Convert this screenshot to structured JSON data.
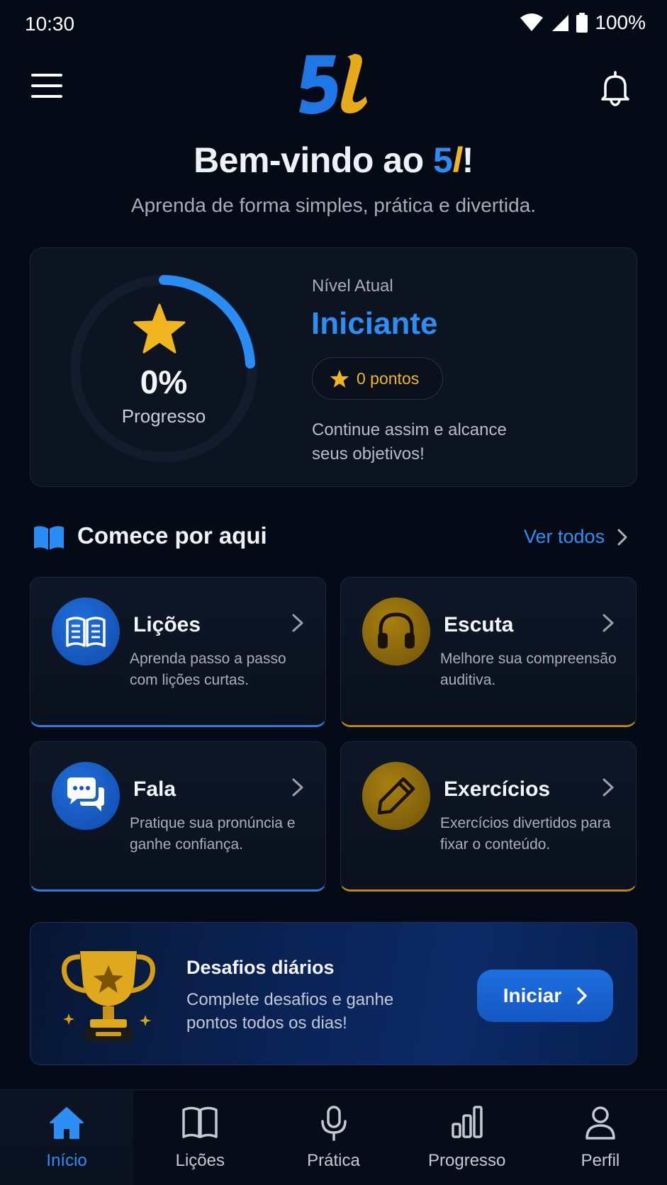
{
  "status_bar": {
    "time": "10:30",
    "battery": "100%"
  },
  "header": {
    "logo_text": "5l"
  },
  "welcome": {
    "title_prefix": "Bem-vindo ao ",
    "brand_5": "5",
    "brand_l": "l",
    "title_suffix": "!",
    "subtitle": "Aprenda de forma simples, prática e divertida."
  },
  "progress": {
    "percent": "0%",
    "percent_value": 0,
    "label": "Progresso",
    "level_caption": "Nível Atual",
    "level_name": "Iniciante",
    "points": "0 pontos",
    "message": "Continue assim e alcance seus objetivos!"
  },
  "section": {
    "title": "Comece por aqui",
    "see_all": "Ver todos"
  },
  "features": [
    {
      "title": "Lições",
      "description": "Aprenda passo a passo com lições curtas.",
      "icon": "book-icon",
      "accent": "#2a7de0"
    },
    {
      "title": "Escuta",
      "description": "Melhore sua compreensão auditiva.",
      "icon": "headphones-icon",
      "accent": "#b68718"
    },
    {
      "title": "Fala",
      "description": "Pratique sua pronúncia e ganhe confiança.",
      "icon": "chat-icon",
      "accent": "#2a7de0"
    },
    {
      "title": "Exercícios",
      "description": "Exercícios divertidos para fixar o conteúdo.",
      "icon": "pencil-icon",
      "accent": "#b68718"
    }
  ],
  "challenge": {
    "title": "Desafios diários",
    "description": "Complete desafios e ganhe pontos todos os dias!",
    "button": "Iniciar"
  },
  "nav": [
    {
      "label": "Início",
      "icon": "home-icon",
      "active": true
    },
    {
      "label": "Lições",
      "icon": "book-icon",
      "active": false
    },
    {
      "label": "Prática",
      "icon": "microphone-icon",
      "active": false
    },
    {
      "label": "Progresso",
      "icon": "bar-chart-icon",
      "active": false
    },
    {
      "label": "Perfil",
      "icon": "user-icon",
      "active": false
    }
  ],
  "colors": {
    "accent_blue": "#2d8ef3",
    "accent_gold": "#f0b51f",
    "background": "#050b16"
  }
}
